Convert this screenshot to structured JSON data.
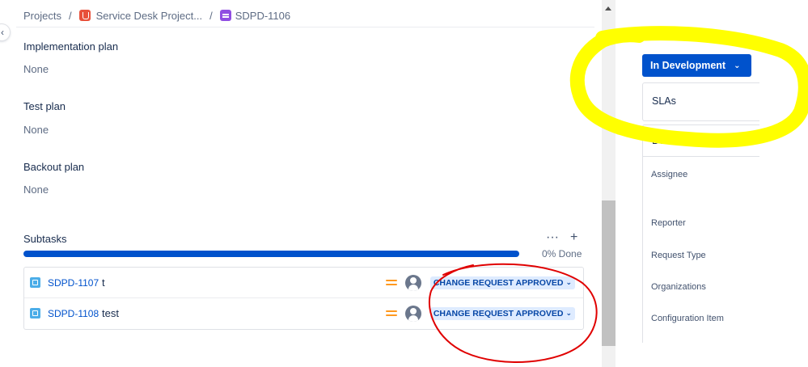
{
  "breadcrumb": {
    "projects": "Projects",
    "sep": "/",
    "project": "Service Desk Project...",
    "issue_key": "SDPD-1106"
  },
  "fields": [
    {
      "label": "Implementation plan",
      "value": "None"
    },
    {
      "label": "Test plan",
      "value": "None"
    },
    {
      "label": "Backout plan",
      "value": "None"
    }
  ],
  "subtasks": {
    "title": "Subtasks",
    "more_icon": "more-icon",
    "add_icon": "plus-icon",
    "progress_percent": 0,
    "progress_label": "0% Done",
    "items": [
      {
        "key": "SDPD-1107",
        "summary": "t",
        "priority_icon": "priority-medium-icon",
        "status": "CHANGE REQUEST APPROVED"
      },
      {
        "key": "SDPD-1108",
        "summary": "test",
        "priority_icon": "priority-medium-icon",
        "status": "CHANGE REQUEST APPROVED"
      }
    ]
  },
  "sidebar": {
    "status_button": "In Development",
    "slas_label": "SLAs",
    "details_label": "Details",
    "detail_fields": [
      "Assignee",
      "Reporter",
      "Request Type",
      "Organizations",
      "Configuration Item"
    ]
  },
  "colors": {
    "primary": "#0052cc",
    "lozenge_bg": "#deebff",
    "lozenge_text": "#0747a6",
    "priority_medium": "#ff991f",
    "annotation_yellow": "#ffff00",
    "annotation_red": "#e00000"
  }
}
